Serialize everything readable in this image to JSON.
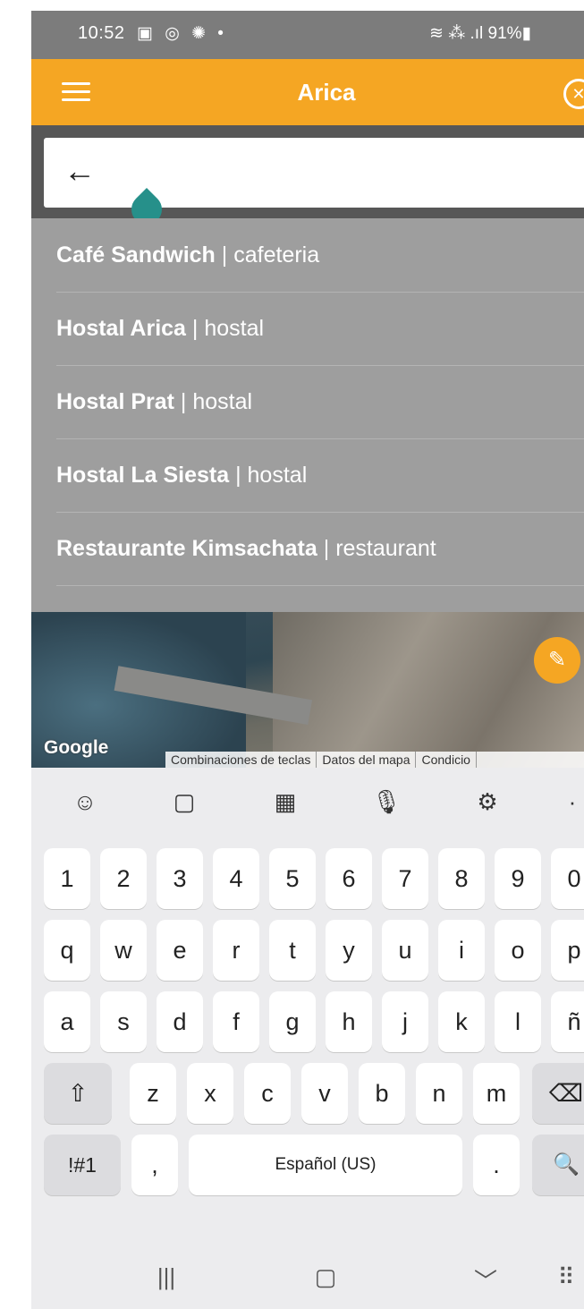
{
  "status_bar": {
    "time": "10:52",
    "notification_icons": [
      "photo-icon",
      "instagram-icon",
      "sun-icon",
      "dot-icon"
    ],
    "notification_glyphs": "▣ ◎ ✺ •",
    "right_text": "≋ ⁂ .ıl 91%▮",
    "battery": "91%"
  },
  "app_bar": {
    "title": "Arica",
    "close_glyph": "✕"
  },
  "search": {
    "back_glyph": "←",
    "value": "",
    "placeholder": ""
  },
  "results": [
    {
      "name": "Café Sandwich",
      "sep": " | ",
      "type": "cafeteria"
    },
    {
      "name": "Hostal Arica",
      "sep": " | ",
      "type": "hostal"
    },
    {
      "name": "Hostal Prat",
      "sep": " | ",
      "type": "hostal"
    },
    {
      "name": "Hostal La Siesta",
      "sep": " | ",
      "type": "hostal"
    },
    {
      "name": "Restaurante Kimsachata",
      "sep": " | ",
      "type": "restaurant"
    }
  ],
  "map": {
    "logo": "Google",
    "footer": [
      "Combinaciones de teclas",
      "Datos del mapa",
      "Condicio"
    ],
    "clear_glyph": "✎",
    "accent": "#f5a623"
  },
  "keyboard": {
    "toolbar": [
      {
        "icon": "emoji-icon",
        "glyph": "☺"
      },
      {
        "icon": "clipboard-icon",
        "glyph": "▢"
      },
      {
        "icon": "keypad-icon",
        "glyph": "▦"
      },
      {
        "icon": "microphone-icon",
        "glyph": "🎙"
      },
      {
        "icon": "settings-icon",
        "glyph": "⚙"
      },
      {
        "icon": "more-icon",
        "glyph": "·"
      }
    ],
    "row_numbers": [
      "1",
      "2",
      "3",
      "4",
      "5",
      "6",
      "7",
      "8",
      "9",
      "0"
    ],
    "row_q": [
      "q",
      "w",
      "e",
      "r",
      "t",
      "y",
      "u",
      "i",
      "o",
      "p"
    ],
    "row_a": [
      "a",
      "s",
      "d",
      "f",
      "g",
      "h",
      "j",
      "k",
      "l",
      "ñ"
    ],
    "row_z": [
      "z",
      "x",
      "c",
      "v",
      "b",
      "n",
      "m"
    ],
    "shift_glyph": "⇧",
    "backspace_glyph": "⌫",
    "symbols_label": "!#1",
    "comma": ",",
    "space_label": "Español (US)",
    "period": ".",
    "search_glyph": "🔍"
  },
  "nav_bar": {
    "recents_glyph": "|||",
    "home_glyph": "▢",
    "back_glyph": "﹀",
    "keyboard_glyph": "⠿"
  },
  "colors": {
    "app_bar": "#f5a623",
    "status_bar": "#7c7c7c",
    "results_bg": "#9e9e9e",
    "caret": "#26908a"
  }
}
